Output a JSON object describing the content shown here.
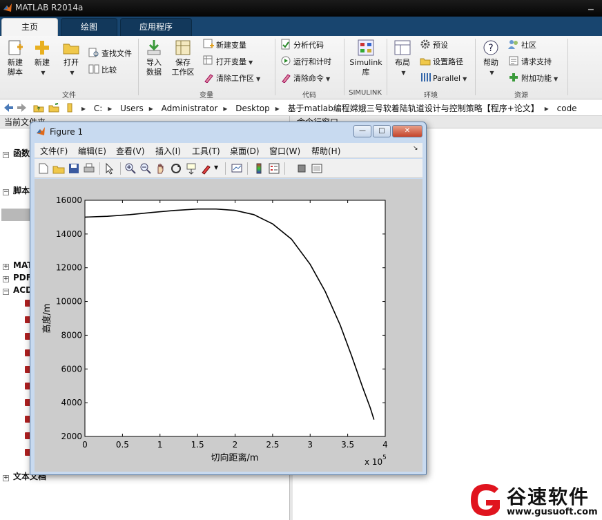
{
  "app": {
    "title": "MATLAB R2014a"
  },
  "tabs": [
    {
      "label": "主页",
      "active": true
    },
    {
      "label": "绘图",
      "active": false
    },
    {
      "label": "应用程序",
      "active": false
    }
  ],
  "ribbon": {
    "file": {
      "group_label": "文件",
      "new_script": "新建\n脚本",
      "new": "新建",
      "open": "打开",
      "find_files": "查找文件",
      "compare": "比较"
    },
    "variable": {
      "group_label": "变量",
      "import": "导入\n数据",
      "save": "保存\n工作区",
      "new_var": "新建变量",
      "open_var": "打开变量",
      "clear_ws": "清除工作区"
    },
    "code": {
      "group_label": "代码",
      "analyze": "分析代码",
      "run_time": "运行和计时",
      "clear_cmd": "清除命令"
    },
    "simulink": {
      "group_label": "SIMULINK",
      "lib": "Simulink\n库"
    },
    "env": {
      "group_label": "环境",
      "layout": "布局",
      "prefs": "预设",
      "set_path": "设置路径",
      "parallel": "Parallel"
    },
    "resources": {
      "group_label": "资源",
      "help": "帮助",
      "community": "社区",
      "support": "请求支持",
      "addons": "附加功能"
    }
  },
  "address": {
    "crumbs": [
      "C:",
      "Users",
      "Administrator",
      "Desktop",
      "基于matlab编程嫦娥三号软着陆轨道设计与控制策略【程序+论文】",
      "code"
    ]
  },
  "left_panel": {
    "title": "当前文件夹",
    "tree": [
      {
        "label": "函数",
        "expanded": true
      },
      {
        "label": "脚本",
        "expanded": true
      },
      {
        "label": "MAT",
        "expanded": false
      },
      {
        "label": "PDF",
        "expanded": false
      },
      {
        "label": "ACD",
        "expanded": true
      },
      {
        "label": "文本文档",
        "expanded": false
      }
    ]
  },
  "right_panel": {
    "title": "命令行窗口"
  },
  "figure": {
    "title": "Figure 1",
    "menus": [
      "文件(F)",
      "编辑(E)",
      "查看(V)",
      "插入(I)",
      "工具(T)",
      "桌面(D)",
      "窗口(W)",
      "帮助(H)"
    ],
    "buttons": {
      "min": "—",
      "max": "□",
      "close": "✕"
    }
  },
  "chart_data": {
    "type": "line",
    "xlabel": "切向距离/m",
    "ylabel": "高度/m",
    "x_multiplier": "x 10",
    "x_multiplier_exp": "5",
    "xlim": [
      0,
      4
    ],
    "ylim": [
      2000,
      16000
    ],
    "xticks": [
      "0",
      "0.5",
      "1",
      "1.5",
      "2",
      "2.5",
      "3",
      "3.5",
      "4"
    ],
    "yticks": [
      "2000",
      "4000",
      "6000",
      "8000",
      "10000",
      "12000",
      "14000",
      "16000"
    ],
    "grid": false,
    "series": [
      {
        "color": "#000000",
        "x": [
          0,
          0.3,
          0.6,
          0.9,
          1.2,
          1.5,
          1.75,
          2.0,
          2.25,
          2.5,
          2.75,
          3.0,
          3.2,
          3.4,
          3.55,
          3.7,
          3.8,
          3.85
        ],
        "y": [
          15000,
          15050,
          15150,
          15280,
          15400,
          15480,
          15480,
          15400,
          15150,
          14600,
          13700,
          12200,
          10600,
          8600,
          6800,
          4900,
          3700,
          3000
        ]
      }
    ]
  },
  "watermark": {
    "brand": "谷速软件",
    "url": "www.gusuoft.com",
    "accent": "#e0141e"
  }
}
